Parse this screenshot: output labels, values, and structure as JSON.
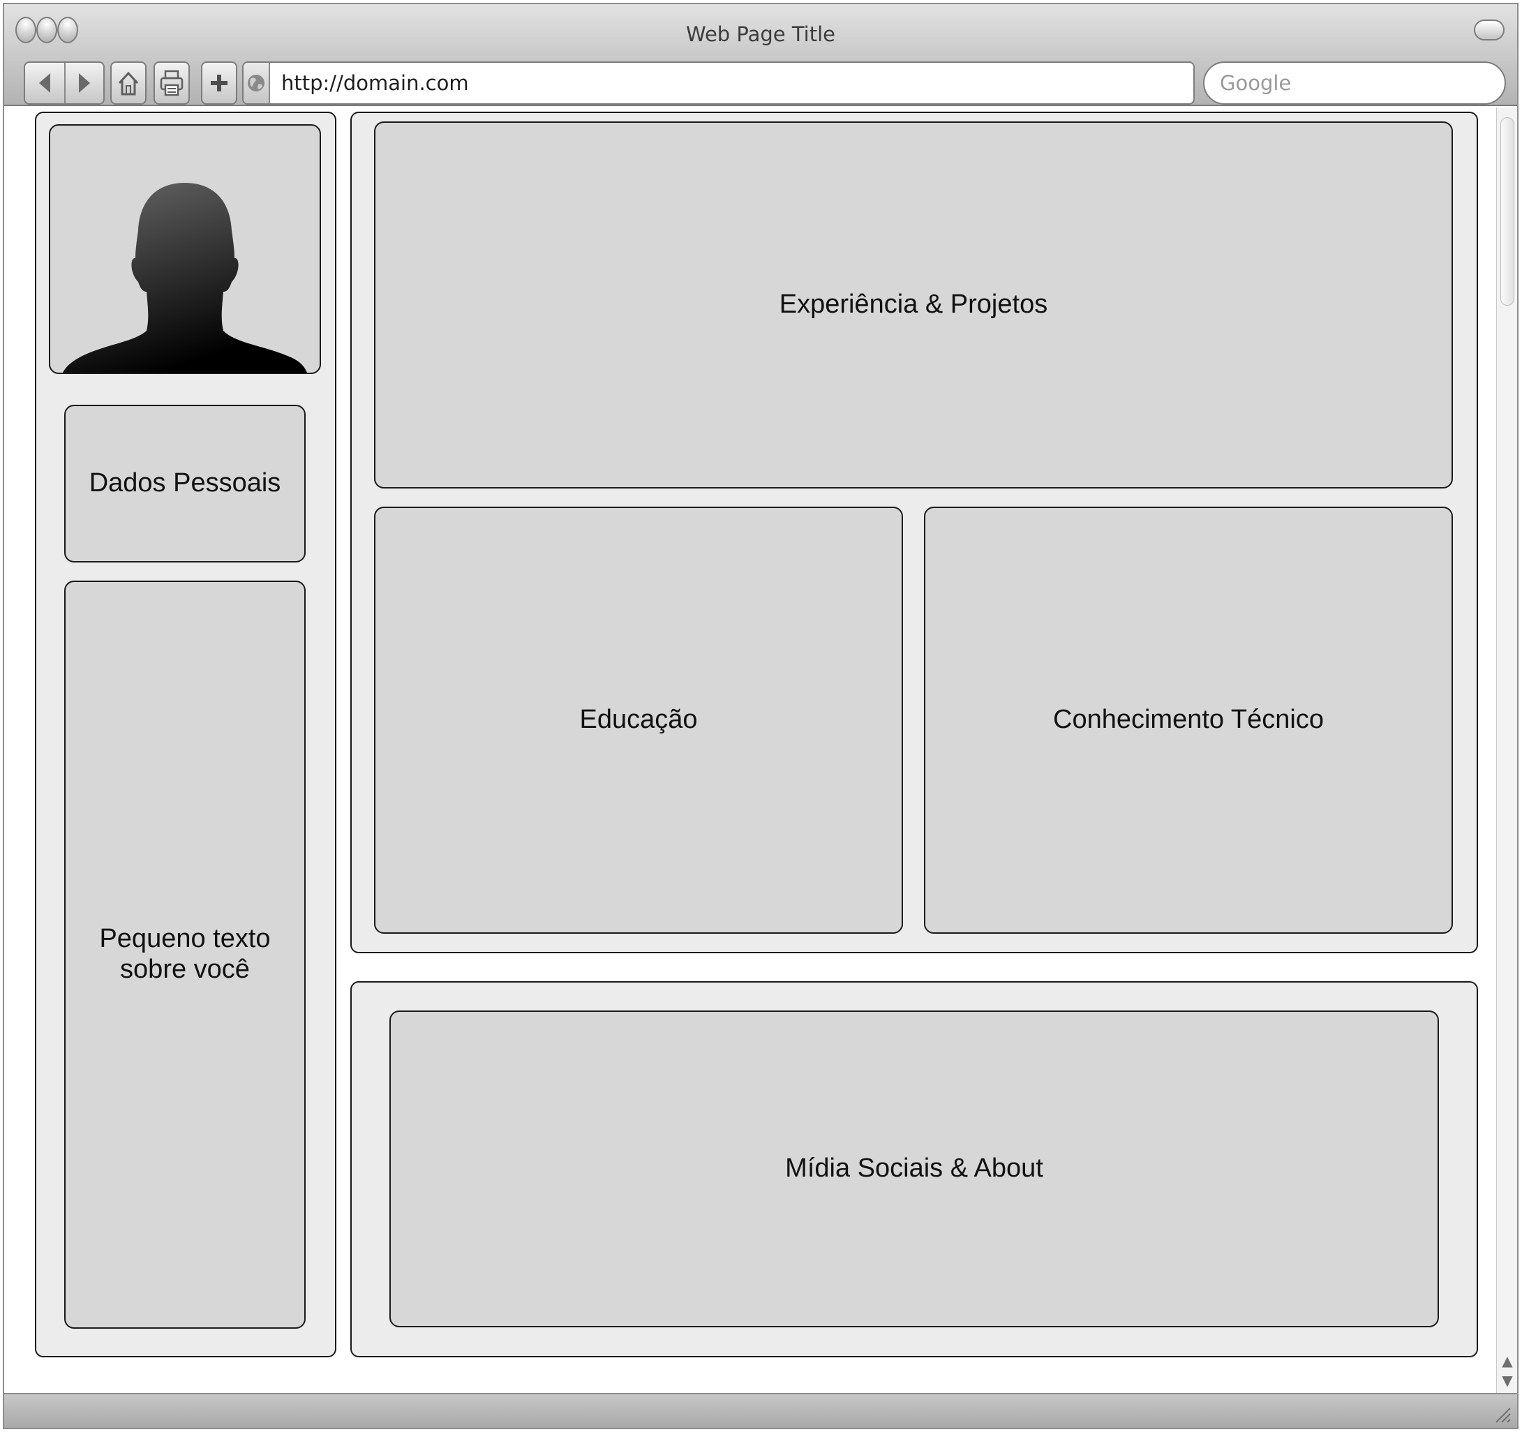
{
  "window": {
    "title": "Web Page Title"
  },
  "toolbar": {
    "back_icon": "back-arrow-icon",
    "forward_icon": "forward-arrow-icon",
    "home_icon": "home-icon",
    "print_icon": "printer-icon",
    "add_icon": "plus-icon"
  },
  "address_bar": {
    "url": "http://domain.com",
    "icon": "globe-icon"
  },
  "search": {
    "placeholder": "Google"
  },
  "sidebar": {
    "photo": "person-silhouette",
    "personal_data": "Dados Pessoais",
    "about_text": "Pequeno texto\nsobre você"
  },
  "main": {
    "experience": "Experiência & Projetos",
    "education": "Educação",
    "skills": "Conhecimento Técnico"
  },
  "footer": {
    "social": "Mídia Sociais & About"
  },
  "colors": {
    "panel_bg": "#ececec",
    "box_bg": "#d7d7d7",
    "border": "#1a1a1a"
  }
}
